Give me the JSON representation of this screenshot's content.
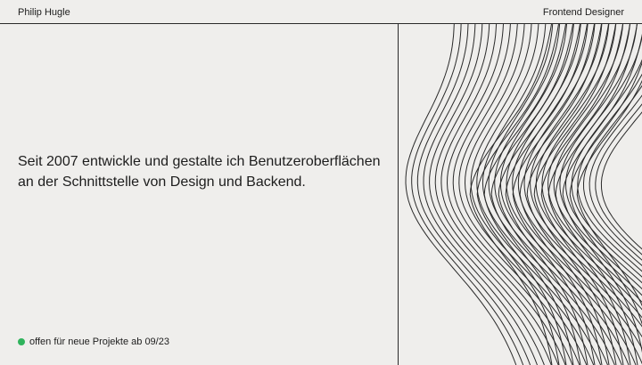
{
  "header": {
    "brand_name": "Philip Hugle",
    "role": "Frontend Designer"
  },
  "hero": {
    "intro_line_1": "Seit 2007 entwickle und gestalte ich Benutzeroberflächen",
    "intro_line_2": "an der Schnittstelle von Design und Backend."
  },
  "availability": {
    "status_text": "offen für neue Projekte ab 09/23",
    "status_color": "#2fb35c"
  },
  "art": {
    "icon": "line-wave-pattern",
    "line_color": "#2a2a2a"
  }
}
